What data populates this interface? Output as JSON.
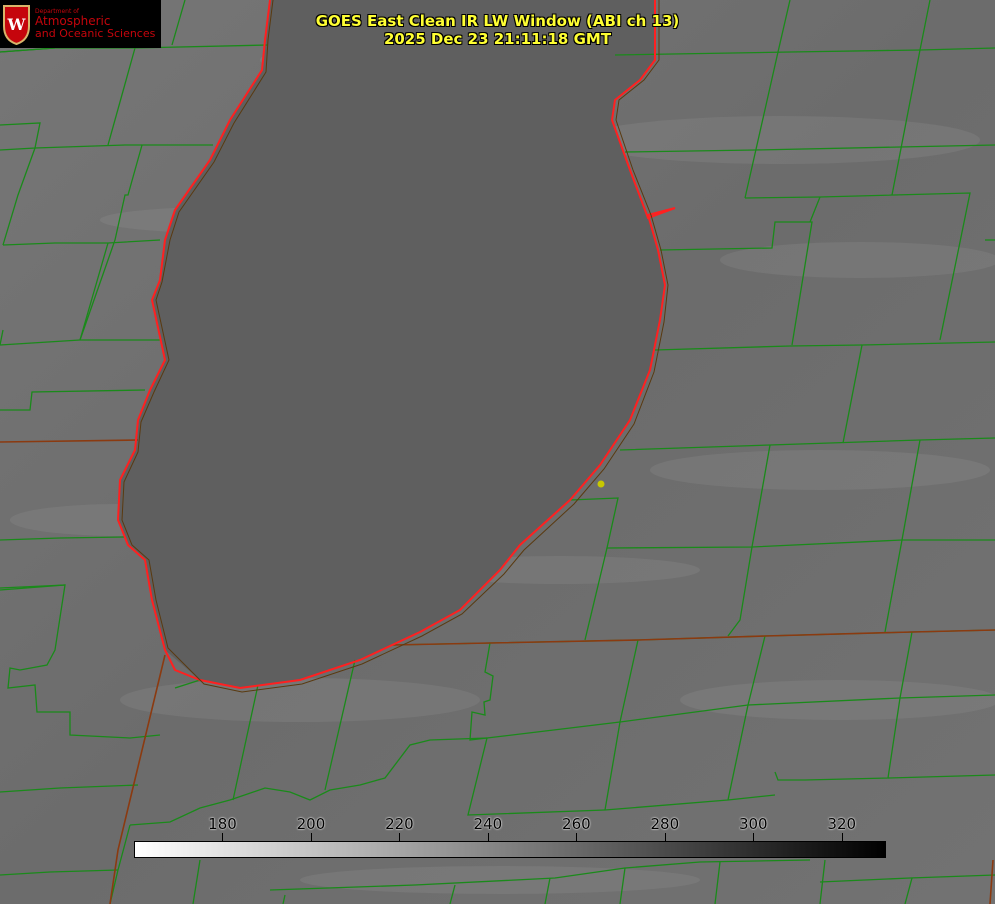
{
  "title": {
    "line1": "GOES East Clean IR LW Window (ABI ch 13)",
    "line2": "2025 Dec 23 21:11:18 GMT"
  },
  "logo": {
    "dept": "Department of",
    "line1": "Atmospheric",
    "line2": "and Oceanic Sciences",
    "seal_letter": "W"
  },
  "colorbar": {
    "ticks": [
      "180",
      "200",
      "220",
      "240",
      "260",
      "280",
      "300",
      "320"
    ],
    "min": 160,
    "max": 330
  },
  "colors": {
    "county_lines": "#1a8a1a",
    "coastline": "#ff2020",
    "state_lines": "#8b3a10",
    "title_text": "#ffff33",
    "marker": "#c8c800",
    "background": "#6e6e6e",
    "lake": "#5e5e5e"
  },
  "layers": [
    "ir-imagery",
    "county-boundaries",
    "state-boundaries",
    "lake-shoreline",
    "station-marker"
  ]
}
